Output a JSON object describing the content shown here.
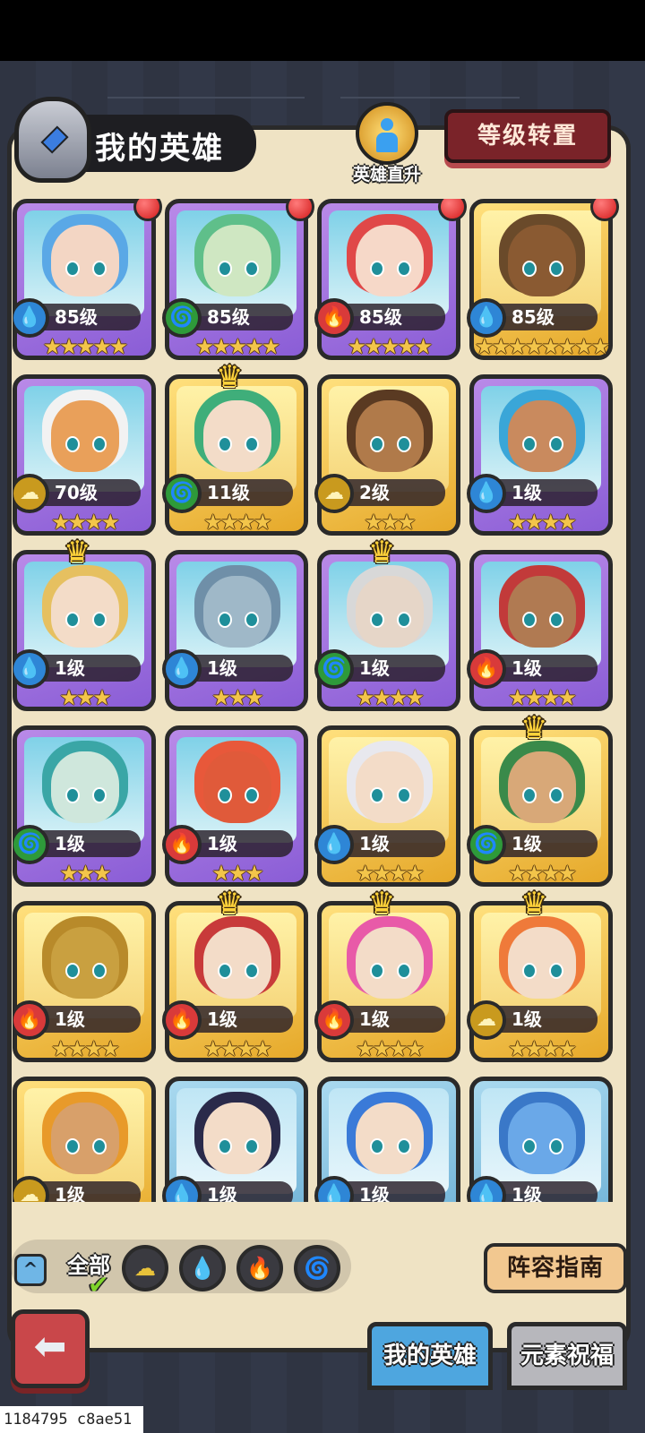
{
  "header": {
    "title": "我的英雄",
    "promote_label": "英雄直升",
    "level_transfer_label": "等级转置"
  },
  "heroes": [
    {
      "level": "85级",
      "element": "water",
      "stars": "★★★★★",
      "frame": "purple",
      "red_dot": true,
      "crown": false,
      "skin": "#f3d6c4",
      "hair": "#5aa8e6"
    },
    {
      "level": "85级",
      "element": "wind",
      "stars": "★★★★★",
      "frame": "purple",
      "red_dot": true,
      "crown": false,
      "skin": "#cfe7c2",
      "hair": "#5fbf8a"
    },
    {
      "level": "85级",
      "element": "fire",
      "stars": "★★★★★",
      "frame": "purple",
      "red_dot": true,
      "crown": false,
      "skin": "#f6d8c8",
      "hair": "#e04848"
    },
    {
      "level": "85级",
      "element": "water",
      "stars": "★★★★★★★★",
      "frame": "gold",
      "red_dot": true,
      "crown": false,
      "skin": "#8a5a32",
      "hair": "#6a4a2a"
    },
    {
      "level": "70级",
      "element": "earth",
      "stars": "★★★★",
      "frame": "purple",
      "red_dot": false,
      "crown": false,
      "skin": "#e9a05a",
      "hair": "#f2f2f2"
    },
    {
      "level": "11级",
      "element": "wind",
      "stars": "★★★★",
      "frame": "gold",
      "red_dot": false,
      "crown": true,
      "skin": "#f3dcc8",
      "hair": "#3fae7a"
    },
    {
      "level": "2级",
      "element": "earth",
      "stars": "★★★",
      "frame": "gold",
      "red_dot": false,
      "crown": false,
      "skin": "#b07a4a",
      "hair": "#5a3a22"
    },
    {
      "level": "1级",
      "element": "water",
      "stars": "★★★★",
      "frame": "purple",
      "red_dot": false,
      "crown": false,
      "skin": "#c98a5e",
      "hair": "#3aa6d8"
    },
    {
      "level": "1级",
      "element": "water",
      "stars": "★★★",
      "frame": "purple",
      "red_dot": false,
      "crown": true,
      "skin": "#f3dcc8",
      "hair": "#e6c060"
    },
    {
      "level": "1级",
      "element": "water",
      "stars": "★★★",
      "frame": "purple",
      "red_dot": false,
      "crown": false,
      "skin": "#9fb8c8",
      "hair": "#6f8fa8"
    },
    {
      "level": "1级",
      "element": "wind",
      "stars": "★★★★",
      "frame": "purple",
      "red_dot": false,
      "crown": true,
      "skin": "#e6d6c8",
      "hair": "#d8d8d8"
    },
    {
      "level": "1级",
      "element": "fire",
      "stars": "★★★★",
      "frame": "purple",
      "red_dot": false,
      "crown": false,
      "skin": "#b07a52",
      "hair": "#c23a3a"
    },
    {
      "level": "1级",
      "element": "wind",
      "stars": "★★★",
      "frame": "purple",
      "red_dot": false,
      "crown": false,
      "skin": "#cfe7dc",
      "hair": "#3aa6a6"
    },
    {
      "level": "1级",
      "element": "fire",
      "stars": "★★★",
      "frame": "purple",
      "red_dot": false,
      "crown": false,
      "skin": "#e05a3a",
      "hair": "#e8583a"
    },
    {
      "level": "1级",
      "element": "water",
      "stars": "★★★★",
      "frame": "gold",
      "red_dot": false,
      "crown": false,
      "skin": "#f3dcc8",
      "hair": "#e8e8ee"
    },
    {
      "level": "1级",
      "element": "wind",
      "stars": "★★★★",
      "frame": "gold",
      "red_dot": false,
      "crown": true,
      "skin": "#d8a878",
      "hair": "#3a8a4a"
    },
    {
      "level": "1级",
      "element": "fire",
      "stars": "★★★★",
      "frame": "gold",
      "red_dot": false,
      "crown": false,
      "skin": "#c9a040",
      "hair": "#b88a2a"
    },
    {
      "level": "1级",
      "element": "fire",
      "stars": "★★★★",
      "frame": "gold",
      "red_dot": false,
      "crown": true,
      "skin": "#f3dcc8",
      "hair": "#c83a3a"
    },
    {
      "level": "1级",
      "element": "fire",
      "stars": "★★★★",
      "frame": "gold",
      "red_dot": false,
      "crown": true,
      "skin": "#f3dcc8",
      "hair": "#e85aa8"
    },
    {
      "level": "1级",
      "element": "earth",
      "stars": "★★★★",
      "frame": "gold",
      "red_dot": false,
      "crown": true,
      "skin": "#f3dcc8",
      "hair": "#ef7a3a"
    },
    {
      "level": "1级",
      "element": "earth",
      "stars": "★★★★",
      "frame": "gold",
      "red_dot": false,
      "crown": false,
      "skin": "#d8a06a",
      "hair": "#e89a2a"
    },
    {
      "level": "1级",
      "element": "water",
      "stars": "★★★★",
      "frame": "blue",
      "red_dot": false,
      "crown": false,
      "skin": "#f3dcc8",
      "hair": "#2a2a4a"
    },
    {
      "level": "1级",
      "element": "water",
      "stars": "★★★★",
      "frame": "blue",
      "red_dot": false,
      "crown": false,
      "skin": "#f3dcc8",
      "hair": "#3a7ad8"
    },
    {
      "level": "1级",
      "element": "water",
      "stars": "★★★★",
      "frame": "blue",
      "red_dot": false,
      "crown": false,
      "skin": "#6aa8e8",
      "hair": "#3a78c8"
    }
  ],
  "filters": {
    "collapse_label": "^",
    "all_label": "全部",
    "check_mark": "✔",
    "elements": [
      {
        "name": "earth",
        "glyph": "☁",
        "color": "#e8c23a"
      },
      {
        "name": "water",
        "glyph": "💧",
        "color": "#3a9ae8"
      },
      {
        "name": "fire",
        "glyph": "🔥",
        "color": "#e84a4a"
      },
      {
        "name": "wind",
        "glyph": "🌀",
        "color": "#5ac83a"
      }
    ]
  },
  "lineup_guide_label": "阵容指南",
  "back_arrow": "⬅",
  "tabs": {
    "active": "我的英雄",
    "inactive": "元素祝福"
  },
  "watermark": "1184795 c8ae51"
}
